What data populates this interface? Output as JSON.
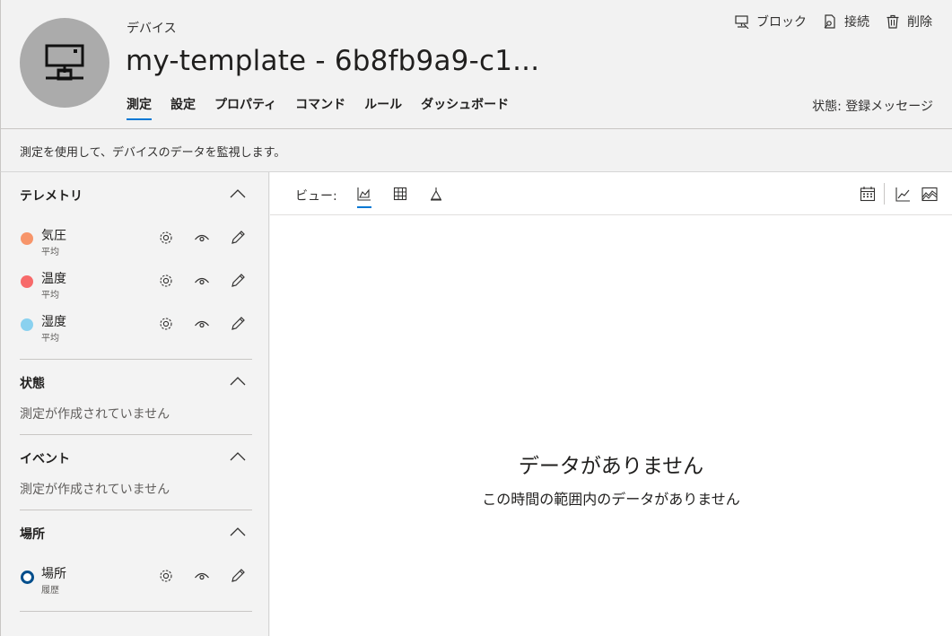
{
  "header": {
    "eyebrow": "デバイス",
    "title": "my-template - 6b8fb9a9-c1...",
    "avatar_icon": "device-icon",
    "tabs": [
      {
        "label": "測定",
        "active": true
      },
      {
        "label": "設定",
        "active": false
      },
      {
        "label": "プロパティ",
        "active": false
      },
      {
        "label": "コマンド",
        "active": false
      },
      {
        "label": "ルール",
        "active": false
      },
      {
        "label": "ダッシュボード",
        "active": false
      }
    ],
    "actions": [
      {
        "label": "ブロック",
        "icon": "block-icon"
      },
      {
        "label": "接続",
        "icon": "connect-icon"
      },
      {
        "label": "削除",
        "icon": "trash-icon"
      }
    ],
    "status": "状態: 登録メッセージ"
  },
  "description": "測定を使用して、デバイスのデータを監視します。",
  "sidebar": {
    "telemetry": {
      "title": "テレメトリ",
      "items": [
        {
          "label": "気圧",
          "sub": "平均",
          "color": "#f7956a"
        },
        {
          "label": "温度",
          "sub": "平均",
          "color": "#f76a6a"
        },
        {
          "label": "湿度",
          "sub": "平均",
          "color": "#8ad1ef"
        }
      ]
    },
    "state": {
      "title": "状態",
      "empty": "測定が作成されていません"
    },
    "events": {
      "title": "イベント",
      "empty": "測定が作成されていません"
    },
    "location": {
      "title": "場所",
      "items": [
        {
          "label": "場所",
          "sub": "履歴",
          "color": "#004e8c"
        }
      ]
    }
  },
  "main": {
    "view_label": "ビュー:",
    "empty_title": "データがありません",
    "empty_sub": "この時間の範囲内のデータがありません"
  },
  "colors": {
    "accent": "#0078d4",
    "avatar_bg": "#ababab"
  }
}
